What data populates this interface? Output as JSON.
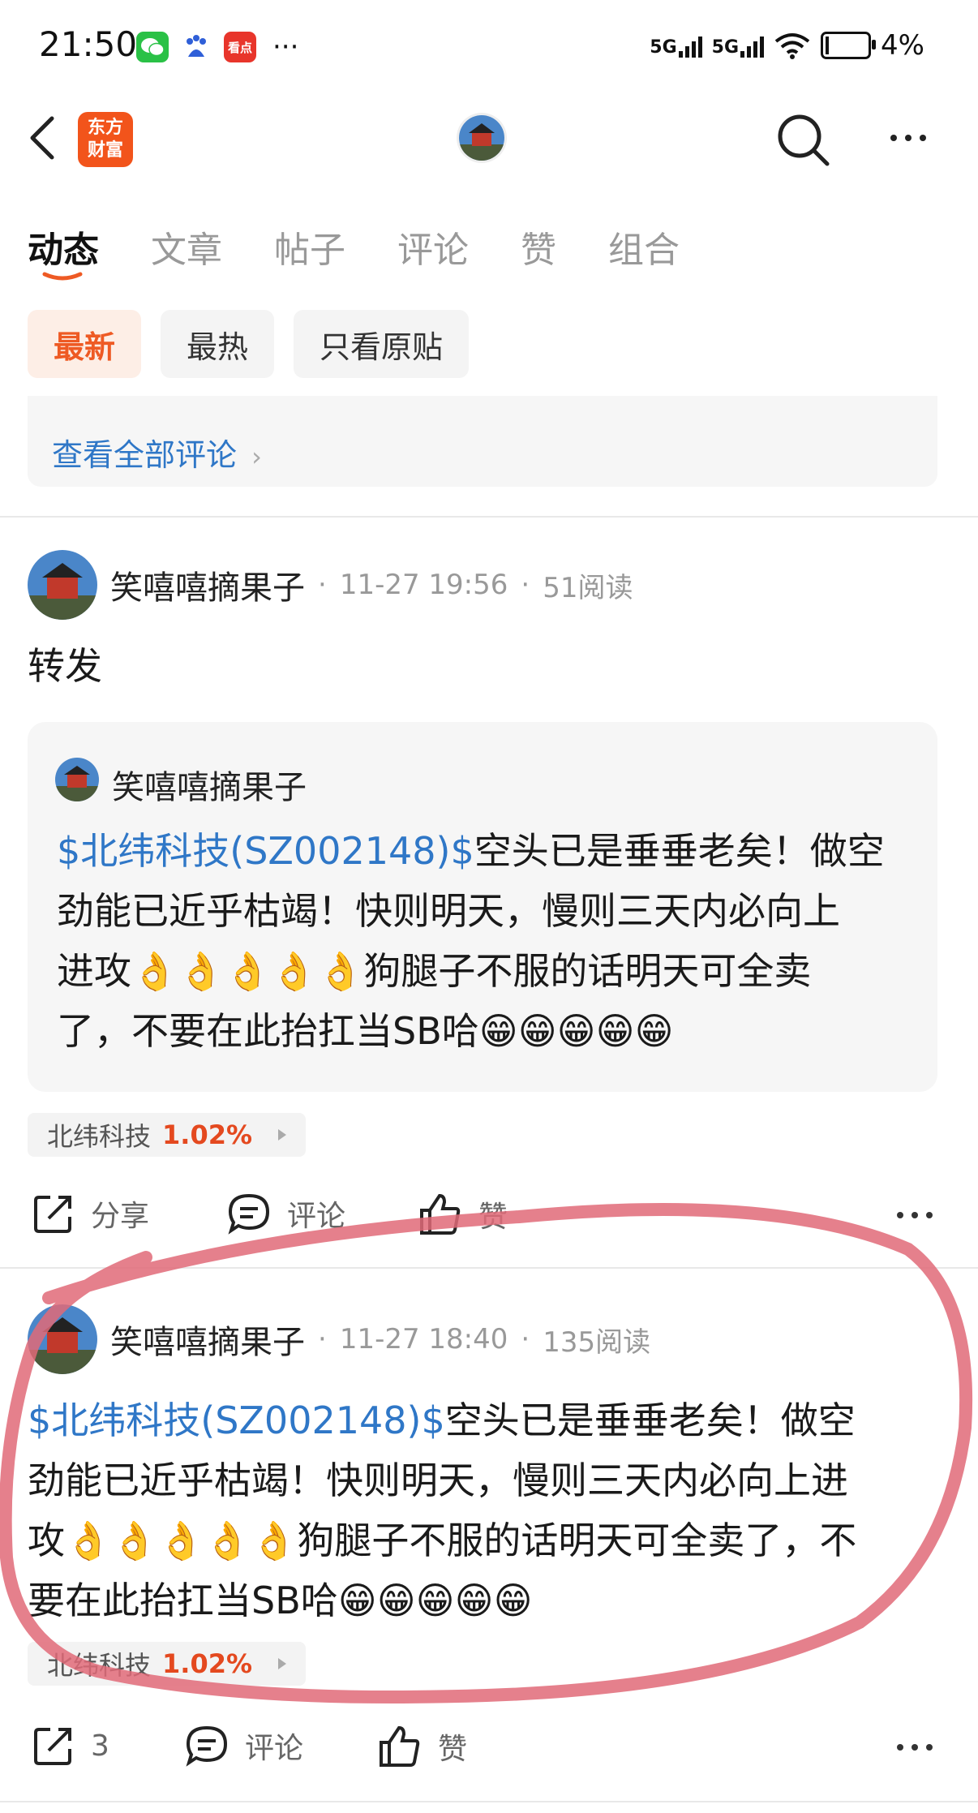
{
  "status_bar": {
    "time": "21:50",
    "app_icons": [
      "wechat-icon",
      "baidu-icon",
      "kandian-icon"
    ],
    "more": "···",
    "network_1": "5G",
    "network_2": "5G",
    "battery": "4%"
  },
  "header": {
    "logo_line1": "东方",
    "logo_line2": "财富"
  },
  "tabs": [
    "动态",
    "文章",
    "帖子",
    "评论",
    "赞",
    "组合"
  ],
  "filters": [
    "最新",
    "最热",
    "只看原贴"
  ],
  "first_card": {
    "view_all": "查看全部评论"
  },
  "posts": [
    {
      "author": "笑嘻嘻摘果子",
      "time": "11-27 19:56",
      "reads": "51阅读",
      "text": "转发",
      "quote": {
        "author": "笑嘻嘻摘果子",
        "lines": [
          {
            "link": "$北纬科技(SZ002148)$",
            "text": "空头已是垂垂老矣！做空"
          },
          {
            "link": "",
            "text": "劲能已近乎枯竭！快则明天，慢则三天内必向上"
          },
          {
            "link": "",
            "text": "进攻👌👌👌👌👌狗腿子不服的话明天可全卖"
          },
          {
            "link": "",
            "text": "了，不要在此抬扛当SB哈😁😁😁😁😁"
          }
        ]
      },
      "stock_name": "北纬科技",
      "stock_change": "1.02%",
      "actions": {
        "share": "分享",
        "comment": "评论",
        "like": "赞"
      }
    },
    {
      "author": "笑嘻嘻摘果子",
      "time": "11-27 18:40",
      "reads": "135阅读",
      "lines": [
        {
          "link": "$北纬科技(SZ002148)$",
          "text": "空头已是垂垂老矣！做空"
        },
        {
          "link": "",
          "text": "劲能已近乎枯竭！快则明天，慢则三天内必向上进"
        },
        {
          "link": "",
          "text": "攻👌👌👌👌👌狗腿子不服的话明天可全卖了，不"
        },
        {
          "link": "",
          "text": "要在此抬扛当SB哈😁😁😁😁😁"
        }
      ],
      "stock_name": "北纬科技",
      "stock_change": "1.02%",
      "actions": {
        "share": "3",
        "comment": "评论",
        "like": "赞"
      }
    }
  ],
  "colors": {
    "accent": "#ee5a24",
    "link": "#2f77c7",
    "stock_up": "#e4491f",
    "annotation_circle": "#e06a78"
  }
}
